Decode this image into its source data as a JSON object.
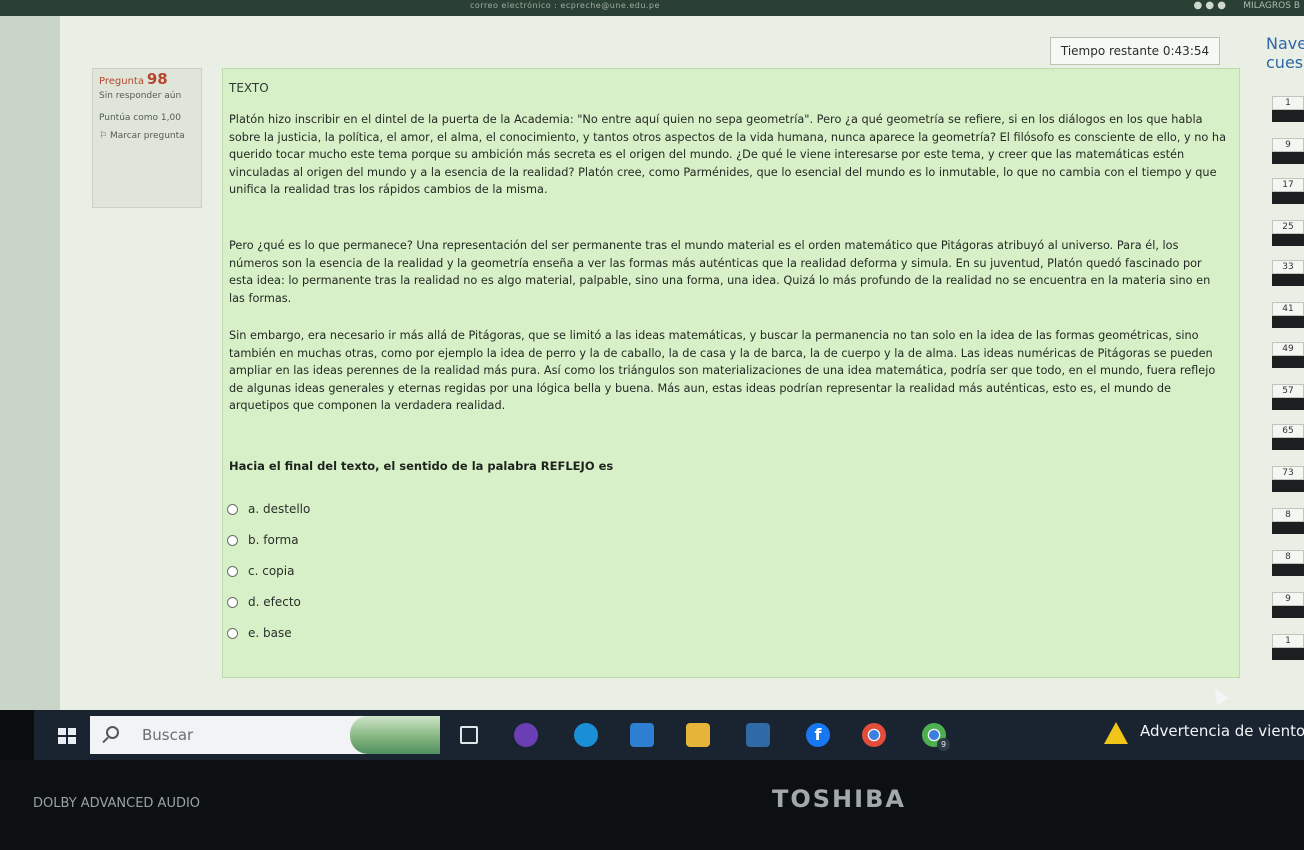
{
  "browser": {
    "url": "correo electrónico : ecpreche@une.edu.pe",
    "user": "MILAGROS B"
  },
  "timer": "Tiempo restante 0:43:54",
  "nav": {
    "title_lines": [
      "Nave",
      "cues"
    ],
    "numbers": [
      "1",
      "9",
      "17",
      "25",
      "33",
      "41",
      "49",
      "57",
      "65",
      "73",
      "8",
      "8",
      "9",
      "1"
    ]
  },
  "question_info": {
    "label": "Pregunta",
    "number": "98",
    "status": "Sin responder aún",
    "score": "Puntúa como 1,00",
    "flag": "Marcar pregunta"
  },
  "content": {
    "heading": "TEXTO",
    "paragraph1": "Platón hizo inscribir en el dintel de la puerta de la Academia: \"No entre aquí quien no sepa geometría\". Pero ¿a qué geometría se refiere, si en los diálogos en los que habla sobre la justicia, la política, el amor, el alma, el conocimiento, y tantos otros aspectos de la vida humana, nunca aparece la geometría? El filósofo es consciente de ello, y no ha querido tocar mucho este tema porque su ambición más secreta es el origen del mundo. ¿De qué le viene interesarse por este tema, y creer que las matemáticas estén vinculadas al origen del mundo y a la esencia de la realidad? Platón cree, como Parménides, que lo esencial del mundo es lo inmutable, lo que no cambia con el tiempo y que unifica la realidad tras los rápidos cambios de la misma.",
    "paragraph2": "Pero ¿qué es lo que permanece? Una representación del ser permanente tras el mundo material es el orden matemático que Pitágoras atribuyó al universo. Para él, los números son la esencia de la realidad y la geometría enseña a ver las formas más auténticas que la realidad deforma y simula. En su juventud, Platón quedó fascinado por esta idea: lo permanente tras la realidad no es algo material, palpable, sino una forma, una idea. Quizá lo más profundo de la realidad no se encuentra en la materia sino en las formas.",
    "paragraph3": "Sin embargo, era necesario ir más allá de Pitágoras, que se limitó a las ideas matemáticas, y buscar la permanencia no tan solo en la idea de las formas geométricas, sino también en muchas otras, como por ejemplo la idea de perro y la de caballo, la de casa y la de barca, la de cuerpo y la de alma. Las ideas numéricas de Pitágoras se pueden ampliar en las ideas perennes de la realidad más pura. Así como los triángulos son materializaciones de una idea matemática, podría ser que todo, en el mundo, fuera reflejo de algunas ideas generales y eternas regidas por una lógica bella y buena. Más aun, estas ideas podrían representar la realidad más auténticas, esto es, el mundo de arquetipos que componen la verdadera realidad.",
    "question": "Hacia el final del texto, el sentido de la palabra REFLEJO es",
    "options": [
      "a. destello",
      "b. forma",
      "c. copia",
      "d. efecto",
      "e. base"
    ]
  },
  "taskbar": {
    "search_placeholder": "Buscar",
    "facebook_glyph": "f",
    "chrome_badge": "9",
    "weather_alert": "Advertencia de viento"
  },
  "bezel": {
    "audio_label": "DOLBY ADVANCED AUDIO",
    "brand": "TOSHIBA"
  }
}
